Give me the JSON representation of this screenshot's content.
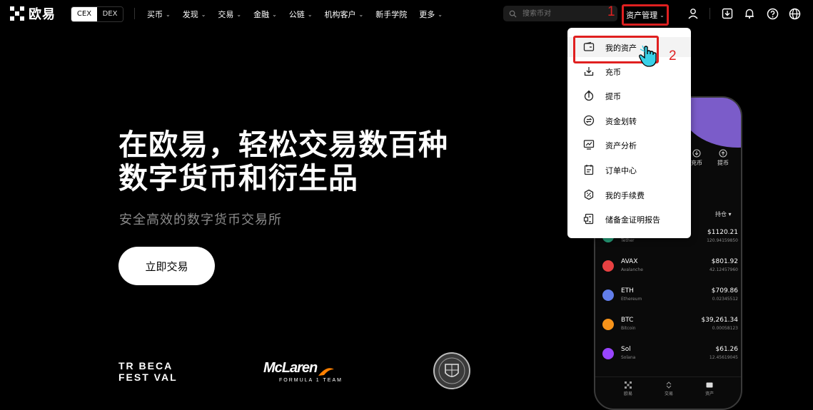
{
  "brand": {
    "name": "欧易"
  },
  "exchange_toggle": {
    "cex": "CEX",
    "dex": "DEX"
  },
  "nav": {
    "items": [
      {
        "label": "买币",
        "chevron": true
      },
      {
        "label": "发现",
        "chevron": true
      },
      {
        "label": "交易",
        "chevron": true
      },
      {
        "label": "金融",
        "chevron": true
      },
      {
        "label": "公链",
        "chevron": true
      },
      {
        "label": "机构客户",
        "chevron": true
      },
      {
        "label": "新手学院",
        "chevron": false
      },
      {
        "label": "更多",
        "chevron": true
      }
    ],
    "search_placeholder": "搜索币对",
    "asset_menu": "资产管理"
  },
  "annotations": {
    "step1": "1",
    "step2": "2"
  },
  "hero": {
    "title_line1": "在欧易，轻松交易数百种",
    "title_line2": "数字货币和衍生品",
    "subtitle": "安全高效的数字货币交易所",
    "cta": "立即交易"
  },
  "partners": {
    "tribeca_line1": "TR BECA",
    "tribeca_line2": "FEST VAL",
    "mclaren": "McLaren",
    "mclaren_sub": "FORMULA 1 TEAM"
  },
  "dropdown": {
    "items": [
      {
        "label": "我的资产",
        "icon": "wallet-icon"
      },
      {
        "label": "充币",
        "icon": "deposit-icon"
      },
      {
        "label": "提币",
        "icon": "withdraw-icon"
      },
      {
        "label": "资金划转",
        "icon": "transfer-icon"
      },
      {
        "label": "资产分析",
        "icon": "analysis-icon"
      },
      {
        "label": "订单中心",
        "icon": "order-icon"
      },
      {
        "label": "我的手续费",
        "icon": "fee-icon"
      },
      {
        "label": "储备金证明报告",
        "icon": "report-icon"
      }
    ]
  },
  "phone": {
    "quick_actions": [
      "充币",
      "提币"
    ],
    "holdings_header": "持仓",
    "coins": [
      {
        "symbol": "",
        "name": "Tether",
        "value": "$1120.21",
        "qty": "120.94159850",
        "color": "#26a17b"
      },
      {
        "symbol": "AVAX",
        "name": "Avalanche",
        "value": "$801.92",
        "qty": "42.12457960",
        "color": "#e84142"
      },
      {
        "symbol": "ETH",
        "name": "Ethereum",
        "value": "$709.86",
        "qty": "0.02345512",
        "color": "#627eea"
      },
      {
        "symbol": "BTC",
        "name": "Bitcoin",
        "value": "$39,261.34",
        "qty": "0.00058123",
        "color": "#f7931a"
      },
      {
        "symbol": "Sol",
        "name": "Solana",
        "value": "$61.26",
        "qty": "12.45619045",
        "color": "#9945ff"
      }
    ],
    "tabs": [
      "欧易",
      "交易",
      "资产"
    ]
  },
  "colors": {
    "highlight": "#e02020",
    "background": "#000000",
    "dropdown_bg": "#ffffff"
  }
}
